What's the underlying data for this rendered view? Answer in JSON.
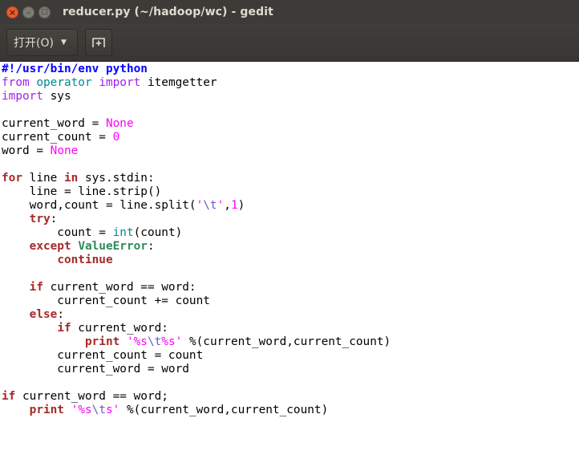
{
  "window": {
    "title": "reducer.py (~/hadoop/wc) - gedit",
    "close_glyph": "×",
    "minimize_glyph": "–",
    "maximize_glyph": "□"
  },
  "toolbar": {
    "open_label": "打开(O)",
    "open_dropdown_glyph": "▼",
    "new_tab_icon": "new-tab-icon"
  },
  "editor": {
    "language": "python",
    "lines": [
      [
        {
          "t": "#!/usr/bin/env python",
          "c": "shebang"
        }
      ],
      [
        {
          "t": "from",
          "c": "kwp"
        },
        {
          "t": " "
        },
        {
          "t": "operator",
          "c": "bi"
        },
        {
          "t": " "
        },
        {
          "t": "import",
          "c": "kwp"
        },
        {
          "t": " itemgetter"
        }
      ],
      [
        {
          "t": "import",
          "c": "kwp"
        },
        {
          "t": " sys"
        }
      ],
      [],
      [
        {
          "t": "current_word = "
        },
        {
          "t": "None",
          "c": "num"
        }
      ],
      [
        {
          "t": "current_count = "
        },
        {
          "t": "0",
          "c": "num"
        }
      ],
      [
        {
          "t": "word = "
        },
        {
          "t": "None",
          "c": "num"
        }
      ],
      [],
      [
        {
          "t": "for",
          "c": "kw"
        },
        {
          "t": " line "
        },
        {
          "t": "in",
          "c": "kw"
        },
        {
          "t": " sys.stdin:"
        }
      ],
      [
        {
          "t": "    line = line.strip()"
        }
      ],
      [
        {
          "t": "    word,count = line.split("
        },
        {
          "t": "'",
          "c": "str"
        },
        {
          "t": "\\t",
          "c": "esc"
        },
        {
          "t": "'",
          "c": "str"
        },
        {
          "t": ","
        },
        {
          "t": "1",
          "c": "num"
        },
        {
          "t": ")"
        }
      ],
      [
        {
          "t": "    "
        },
        {
          "t": "try",
          "c": "kw"
        },
        {
          "t": ":"
        }
      ],
      [
        {
          "t": "        count = "
        },
        {
          "t": "int",
          "c": "bi"
        },
        {
          "t": "(count)"
        }
      ],
      [
        {
          "t": "    "
        },
        {
          "t": "except",
          "c": "kw"
        },
        {
          "t": " "
        },
        {
          "t": "ValueError",
          "c": "exc"
        },
        {
          "t": ":"
        }
      ],
      [
        {
          "t": "        "
        },
        {
          "t": "continue",
          "c": "kw"
        }
      ],
      [],
      [
        {
          "t": "    "
        },
        {
          "t": "if",
          "c": "kw"
        },
        {
          "t": " current_word == word:"
        }
      ],
      [
        {
          "t": "        current_count += count"
        }
      ],
      [
        {
          "t": "    "
        },
        {
          "t": "else",
          "c": "kw"
        },
        {
          "t": ":"
        }
      ],
      [
        {
          "t": "        "
        },
        {
          "t": "if",
          "c": "kw"
        },
        {
          "t": " current_word:"
        }
      ],
      [
        {
          "t": "            "
        },
        {
          "t": "print",
          "c": "kw"
        },
        {
          "t": " "
        },
        {
          "t": "'%s",
          "c": "str"
        },
        {
          "t": "\\t",
          "c": "esc"
        },
        {
          "t": "%s'",
          "c": "str"
        },
        {
          "t": " %(current_word,current_count)"
        }
      ],
      [
        {
          "t": "        current_count = count"
        }
      ],
      [
        {
          "t": "        current_word = word"
        }
      ],
      [],
      [
        {
          "t": "if",
          "c": "kw"
        },
        {
          "t": " current_word == word;"
        }
      ],
      [
        {
          "t": "    "
        },
        {
          "t": "print",
          "c": "kw"
        },
        {
          "t": " "
        },
        {
          "t": "'%s",
          "c": "str"
        },
        {
          "t": "\\t",
          "c": "esc"
        },
        {
          "t": "s'",
          "c": "str"
        },
        {
          "t": " %(current_word,current_count)"
        }
      ]
    ]
  },
  "colors": {
    "titlebar_bg": "#3c3b37",
    "close_button": "#ec5a32",
    "keyword": "#a52a2a",
    "keyword_import": "#a020f0",
    "builtin": "#008a8c",
    "constant": "#ff00ff",
    "exception": "#2e8b57",
    "shebang": "#0000ff"
  }
}
